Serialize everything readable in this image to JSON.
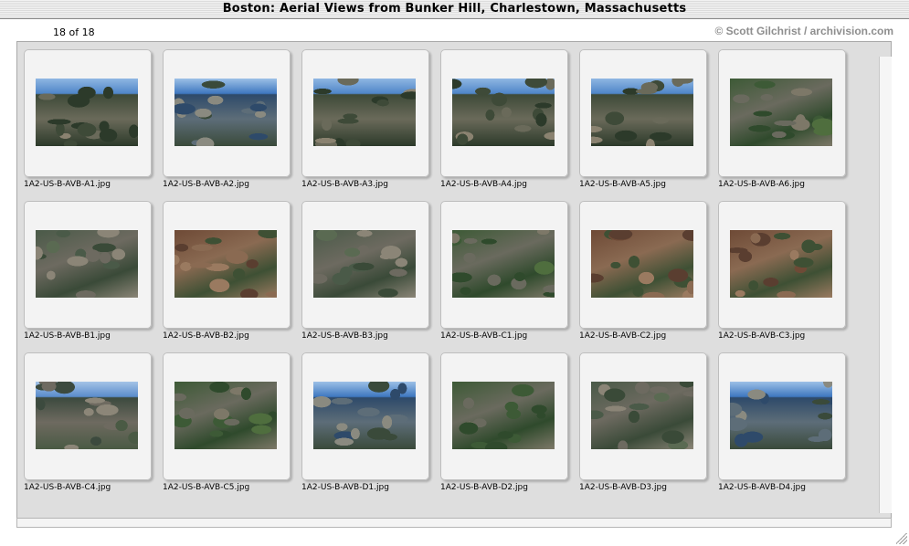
{
  "window": {
    "title": "Boston: Aerial Views from Bunker Hill, Charlestown, Massachusetts"
  },
  "toolbar": {
    "counter": "18 of 18",
    "copyright": "© Scott Gilchrist / archivision.com"
  },
  "thumbnails": [
    {
      "filename": "1A2-US-B-AVB-A1.jpg",
      "scene": "skyline"
    },
    {
      "filename": "1A2-US-B-AVB-A2.jpg",
      "scene": "skyline-harbor"
    },
    {
      "filename": "1A2-US-B-AVB-A3.jpg",
      "scene": "skyline"
    },
    {
      "filename": "1A2-US-B-AVB-A4.jpg",
      "scene": "skyline"
    },
    {
      "filename": "1A2-US-B-AVB-A5.jpg",
      "scene": "skyline"
    },
    {
      "filename": "1A2-US-B-AVB-A6.jpg",
      "scene": "rowhouses-green"
    },
    {
      "filename": "1A2-US-B-AVB-B1.jpg",
      "scene": "rowhouses"
    },
    {
      "filename": "1A2-US-B-AVB-B2.jpg",
      "scene": "rowhouses-red"
    },
    {
      "filename": "1A2-US-B-AVB-B3.jpg",
      "scene": "rowhouses"
    },
    {
      "filename": "1A2-US-B-AVB-C1.jpg",
      "scene": "rowhouses-green"
    },
    {
      "filename": "1A2-US-B-AVB-C2.jpg",
      "scene": "rowhouses-red"
    },
    {
      "filename": "1A2-US-B-AVB-C3.jpg",
      "scene": "rowhouses-red"
    },
    {
      "filename": "1A2-US-B-AVB-C4.jpg",
      "scene": "skyline-low"
    },
    {
      "filename": "1A2-US-B-AVB-C5.jpg",
      "scene": "rowhouses-green"
    },
    {
      "filename": "1A2-US-B-AVB-D1.jpg",
      "scene": "skyline-harbor"
    },
    {
      "filename": "1A2-US-B-AVB-D2.jpg",
      "scene": "rowhouses-green"
    },
    {
      "filename": "1A2-US-B-AVB-D3.jpg",
      "scene": "rowhouses"
    },
    {
      "filename": "1A2-US-B-AVB-D4.jpg",
      "scene": "skyline-harbor"
    }
  ]
}
